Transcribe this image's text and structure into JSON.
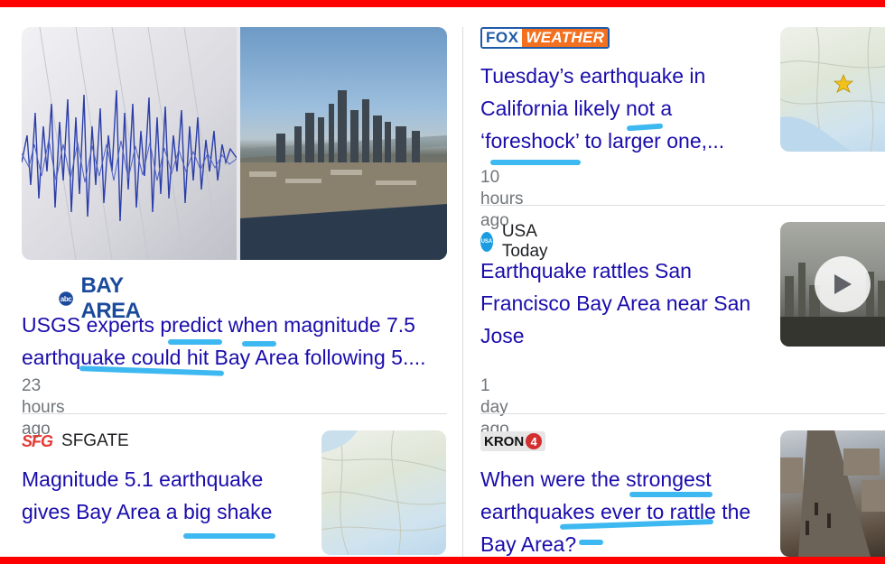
{
  "colors": {
    "link": "#1a0dab",
    "time": "#70757a",
    "frame": "#ff0000",
    "annotation": "#3db8f0"
  },
  "articles": [
    {
      "source": "BAY AREA",
      "source_logo": "abc7-logo",
      "headline_lines": [
        "USGS experts predict when magnitude 7.5",
        "earthquake could hit Bay Area following 5...."
      ],
      "time": "23 hours ago",
      "image": "seismograph-and-san-francisco-skyline"
    },
    {
      "source": "SFGATE",
      "source_logo": "sfg-logo",
      "headline_lines": [
        "Magnitude 5.1 earthquake",
        "gives Bay Area a big shake"
      ],
      "image": "map-thumbnail"
    },
    {
      "source_logo_text": {
        "left": "FOX",
        "right": "WEATHER"
      },
      "headline_lines": [
        "Tuesday’s earthquake in",
        "California likely not a",
        "‘foreshock’ to larger one,..."
      ],
      "time": "10 hours ago",
      "image": "epicenter-map-thumbnail"
    },
    {
      "source": "USA Today",
      "source_logo": "usa-today-logo",
      "headline_lines": [
        "Earthquake rattles San",
        "Francisco Bay Area near San",
        "Jose"
      ],
      "time": "1 day ago",
      "image": "video-thumbnail",
      "icon": "play-icon"
    },
    {
      "source_logo_text": {
        "left": "KRON",
        "right": "4"
      },
      "headline_lines": [
        "When were the strongest",
        "earthquakes ever to rattle the",
        "Bay Area?"
      ],
      "image": "damaged-street-thumbnail"
    }
  ]
}
